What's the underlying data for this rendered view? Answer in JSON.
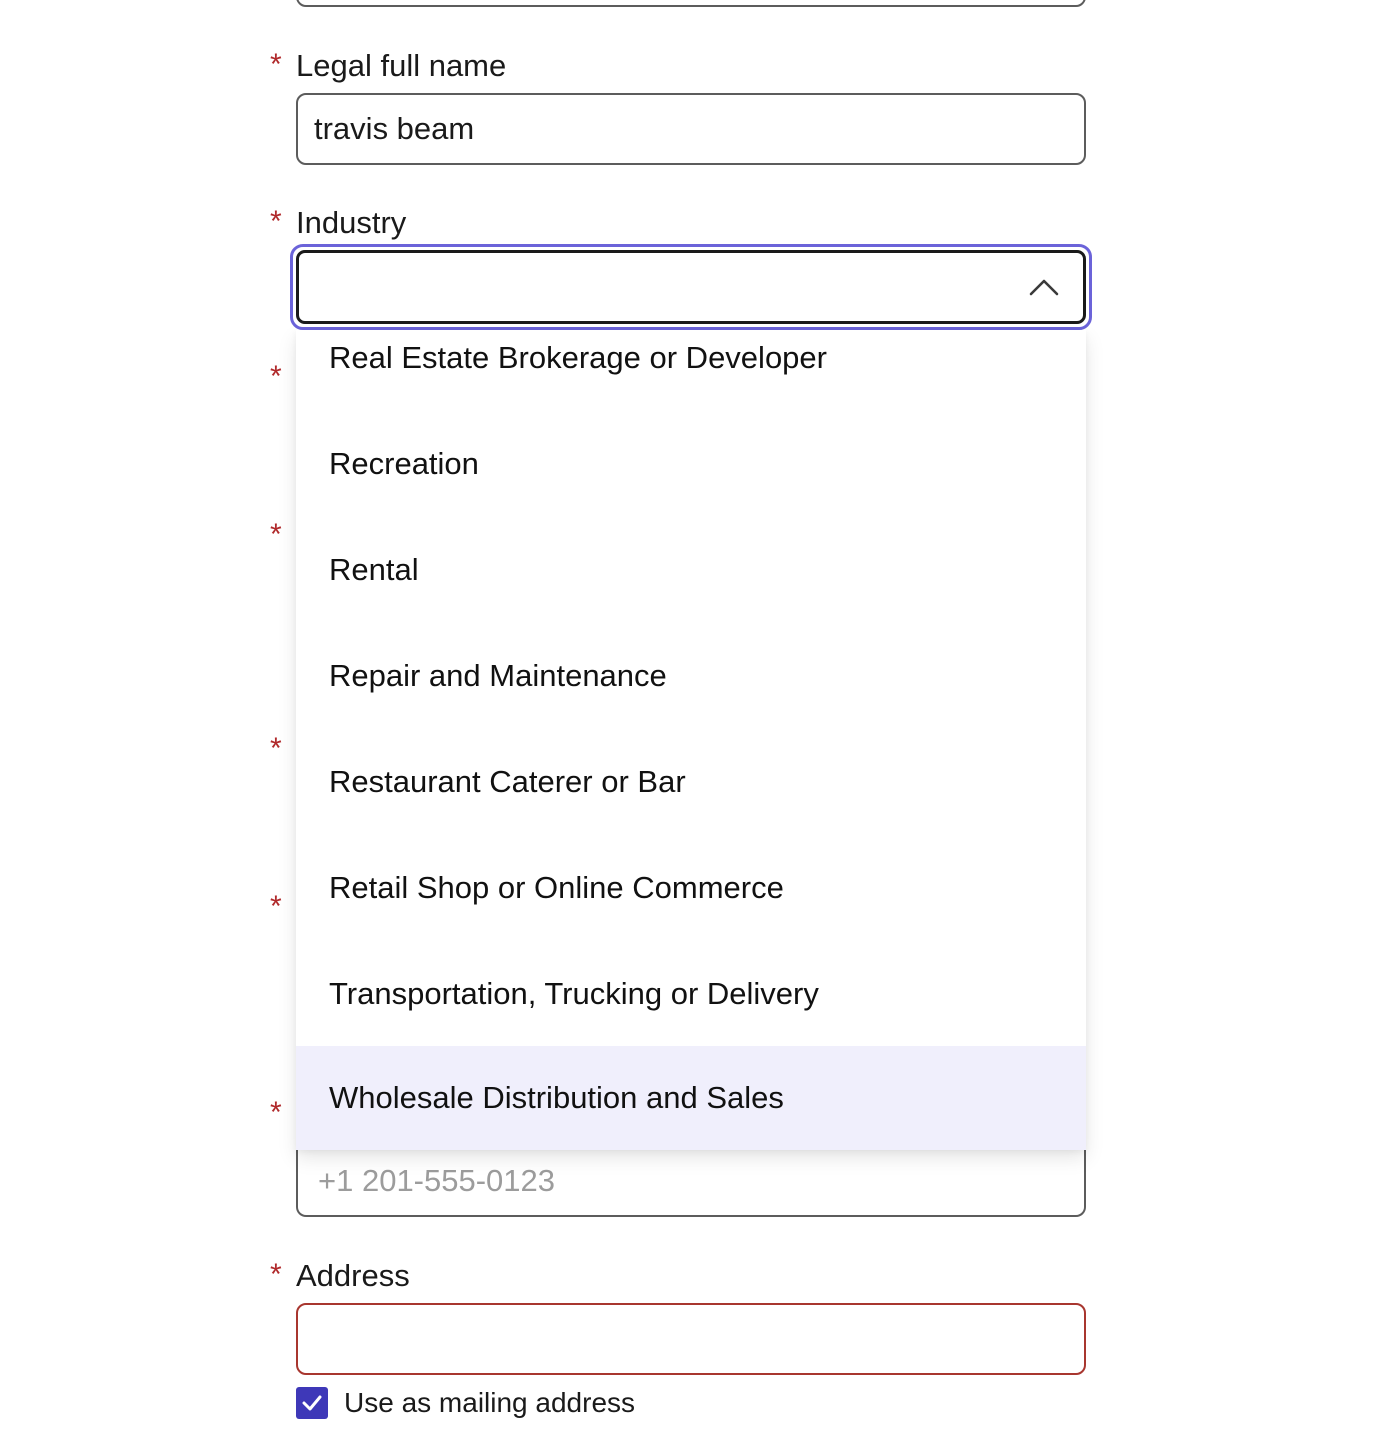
{
  "form": {
    "legal_name": {
      "label": "Legal full name",
      "value": "travis beam"
    },
    "industry": {
      "label": "Industry",
      "value": "",
      "expanded": true,
      "options": [
        {
          "label": "Real Estate Brokerage or Developer"
        },
        {
          "label": "Recreation"
        },
        {
          "label": "Rental"
        },
        {
          "label": "Repair and Maintenance"
        },
        {
          "label": "Restaurant Caterer or Bar"
        },
        {
          "label": "Retail Shop or Online Commerce"
        },
        {
          "label": "Transportation, Trucking or Delivery"
        },
        {
          "label": "Wholesale Distribution and Sales",
          "highlighted": true
        }
      ]
    },
    "phone": {
      "placeholder": "+1 201-555-0123"
    },
    "address": {
      "label": "Address",
      "value": ""
    },
    "mailing": {
      "label": "Use as mailing address",
      "checked": true
    },
    "required_marker": "*"
  },
  "colors": {
    "required": "#b0292b",
    "focus_ring": "#6b63d9",
    "checkbox": "#3e38b8",
    "highlight_row": "#f0effc",
    "error_border": "#a8362f"
  },
  "icons": {
    "select_toggle": "chevron-up-icon",
    "checkbox_mark": "checkmark-icon"
  }
}
